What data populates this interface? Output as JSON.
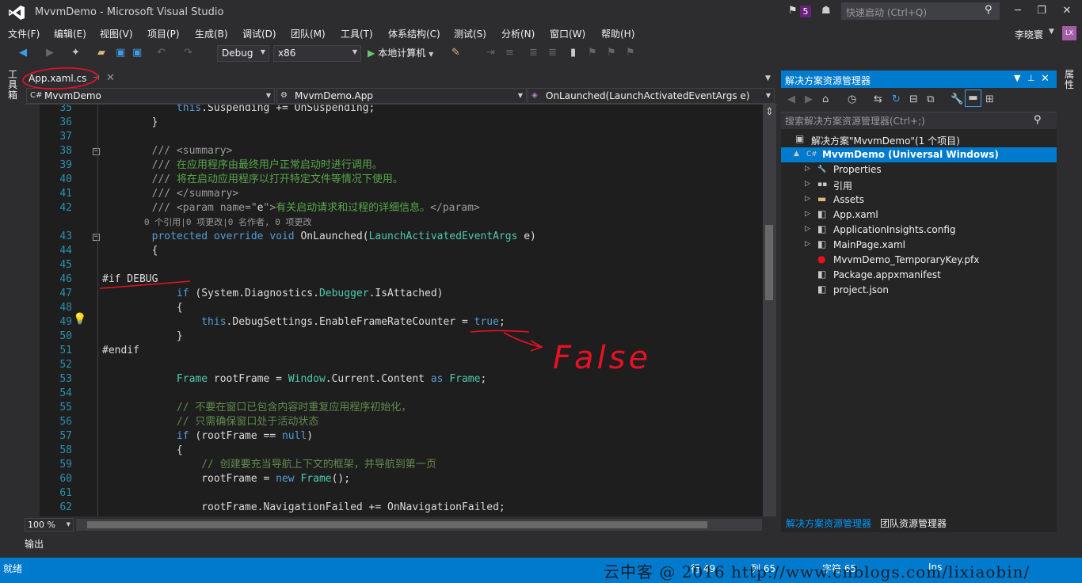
{
  "titlebar": {
    "title": "MvvmDemo - Microsoft Visual Studio",
    "notif_count": "5",
    "quicklaunch_placeholder": "快速启动 (Ctrl+Q)"
  },
  "menu": [
    "文件(F)",
    "编辑(E)",
    "视图(V)",
    "项目(P)",
    "生成(B)",
    "调试(D)",
    "团队(M)",
    "工具(T)",
    "体系结构(C)",
    "测试(S)",
    "分析(N)",
    "窗口(W)",
    "帮助(H)"
  ],
  "user": {
    "name": "李晓寰",
    "initials": "LX"
  },
  "toolbar": {
    "config": "Debug",
    "platform": "x86",
    "run_label": "本地计算机"
  },
  "toolbox_label": "工具箱",
  "document": {
    "tab_label": "App.xaml.cs",
    "nav_project": "MvvmDemo",
    "nav_class": "MvvmDemo.App",
    "nav_member": "OnLaunched(LaunchActivatedEventArgs e)"
  },
  "code": {
    "lines": [
      {
        "n": "35",
        "parts": [
          [
            "",
            "            "
          ],
          [
            "kw",
            "this"
          ],
          [
            "",
            ".Suspending += OnSuspending;"
          ]
        ]
      },
      {
        "n": "36",
        "parts": [
          [
            "",
            "        }"
          ]
        ]
      },
      {
        "n": "37",
        "parts": []
      },
      {
        "n": "38",
        "parts": [
          [
            "gr",
            "        /// <summary>"
          ]
        ]
      },
      {
        "n": "39",
        "parts": [
          [
            "gr",
            "        /// "
          ],
          [
            "cm",
            "在应用程序由最终用户正常启动时进行调用。"
          ]
        ]
      },
      {
        "n": "40",
        "parts": [
          [
            "gr",
            "        /// "
          ],
          [
            "cm",
            "将在启动应用程序以打开特定文件等情况下使用。"
          ]
        ]
      },
      {
        "n": "41",
        "parts": [
          [
            "gr",
            "        /// </summary>"
          ]
        ]
      },
      {
        "n": "42",
        "parts": [
          [
            "gr",
            "        /// <param name=\""
          ],
          [
            "",
            "e"
          ],
          [
            "gr",
            "\">"
          ],
          [
            "cm",
            "有关启动请求和过程的详细信息。"
          ],
          [
            "gr",
            "</param>"
          ]
        ]
      },
      {
        "n": "",
        "parts": [
          [
            "lens",
            "        0 个引用|0 项更改|0 名作者, 0 项更改"
          ]
        ]
      },
      {
        "n": "43",
        "parts": [
          [
            "",
            "        "
          ],
          [
            "kw",
            "protected override void"
          ],
          [
            "",
            " OnLaunched("
          ],
          [
            "ty",
            "LaunchActivatedEventArgs"
          ],
          [
            "",
            " e)"
          ]
        ]
      },
      {
        "n": "44",
        "parts": [
          [
            "",
            "        {"
          ]
        ]
      },
      {
        "n": "45",
        "parts": []
      },
      {
        "n": "46",
        "parts": [
          [
            "",
            "#if DEBUG"
          ]
        ]
      },
      {
        "n": "47",
        "parts": [
          [
            "",
            "            "
          ],
          [
            "kw",
            "if"
          ],
          [
            "",
            " (System.Diagnostics."
          ],
          [
            "ty",
            "Debugger"
          ],
          [
            "",
            ".IsAttached)"
          ]
        ]
      },
      {
        "n": "48",
        "parts": [
          [
            "",
            "            {"
          ]
        ]
      },
      {
        "n": "49",
        "parts": [
          [
            "",
            "                "
          ],
          [
            "kw",
            "this"
          ],
          [
            "",
            ".DebugSettings.EnableFrameRateCounter = "
          ],
          [
            "kw",
            "true"
          ],
          [
            "",
            ";"
          ]
        ]
      },
      {
        "n": "50",
        "parts": [
          [
            "",
            "            }"
          ]
        ]
      },
      {
        "n": "51",
        "parts": [
          [
            "",
            "#endif"
          ]
        ]
      },
      {
        "n": "52",
        "parts": []
      },
      {
        "n": "53",
        "parts": [
          [
            "",
            "            "
          ],
          [
            "ty",
            "Frame"
          ],
          [
            "",
            " rootFrame = "
          ],
          [
            "ty",
            "Window"
          ],
          [
            "",
            ".Current.Content "
          ],
          [
            "kw",
            "as"
          ],
          [
            "",
            " "
          ],
          [
            "ty",
            "Frame"
          ],
          [
            "",
            ";"
          ]
        ]
      },
      {
        "n": "54",
        "parts": []
      },
      {
        "n": "55",
        "parts": [
          [
            "cmx",
            "            // 不要在窗口已包含内容时重复应用程序初始化，"
          ]
        ]
      },
      {
        "n": "56",
        "parts": [
          [
            "cmx",
            "            // 只需确保窗口处于活动状态"
          ]
        ]
      },
      {
        "n": "57",
        "parts": [
          [
            "",
            "            "
          ],
          [
            "kw",
            "if"
          ],
          [
            "",
            " (rootFrame == "
          ],
          [
            "kw",
            "null"
          ],
          [
            "",
            ")"
          ]
        ]
      },
      {
        "n": "58",
        "parts": [
          [
            "",
            "            {"
          ]
        ]
      },
      {
        "n": "59",
        "parts": [
          [
            "cmx",
            "                // 创建要充当导航上下文的框架，并导航到第一页"
          ]
        ]
      },
      {
        "n": "60",
        "parts": [
          [
            "",
            "                rootFrame = "
          ],
          [
            "kw",
            "new"
          ],
          [
            "",
            " "
          ],
          [
            "ty",
            "Frame"
          ],
          [
            "",
            "();"
          ]
        ]
      },
      {
        "n": "61",
        "parts": []
      },
      {
        "n": "62",
        "parts": [
          [
            "",
            "                rootFrame.NavigationFailed += OnNavigationFailed;"
          ]
        ]
      }
    ]
  },
  "zoom": "100 %",
  "output_tab": "输出",
  "solution_explorer": {
    "title": "解决方案资源管理器",
    "search_placeholder": "搜索解决方案资源管理器(Ctrl+;)",
    "items": [
      {
        "label": "解决方案\"MvvmDemo\"(1 个项目)",
        "indent": 0,
        "icon": "solution-icon",
        "expander": ""
      },
      {
        "label": "MvvmDemo (Universal Windows)",
        "indent": 1,
        "icon": "csharp-project-icon",
        "expander": "▲",
        "selected": true
      },
      {
        "label": "Properties",
        "indent": 2,
        "icon": "wrench-icon",
        "expander": "▷"
      },
      {
        "label": "引用",
        "indent": 2,
        "icon": "references-icon",
        "expander": "▷"
      },
      {
        "label": "Assets",
        "indent": 2,
        "icon": "folder-icon",
        "expander": "▷"
      },
      {
        "label": "App.xaml",
        "indent": 2,
        "icon": "xaml-file-icon",
        "expander": "▷"
      },
      {
        "label": "ApplicationInsights.config",
        "indent": 2,
        "icon": "config-file-icon",
        "expander": "▷"
      },
      {
        "label": "MainPage.xaml",
        "indent": 2,
        "icon": "xaml-file-icon",
        "expander": "▷"
      },
      {
        "label": "MvvmDemo_TemporaryKey.pfx",
        "indent": 2,
        "icon": "key-file-icon",
        "expander": ""
      },
      {
        "label": "Package.appxmanifest",
        "indent": 2,
        "icon": "manifest-file-icon",
        "expander": ""
      },
      {
        "label": "project.json",
        "indent": 2,
        "icon": "json-file-icon",
        "expander": ""
      }
    ],
    "bottom_tabs": [
      "解决方案资源管理器",
      "团队资源管理器"
    ]
  },
  "properties_label": "属性",
  "status": {
    "text": "就绪",
    "line": "行 49",
    "col": "列 65",
    "char": "字符 65",
    "mode": "Ins",
    "watermark": "云中客 @ 2016  http://www.cnblogs.com/lixiaobin/"
  },
  "annotation": {
    "text": "False"
  },
  "colors": {
    "accent": "#007acc",
    "annotation": "#e81123",
    "editor_bg": "#1e1e1e"
  }
}
